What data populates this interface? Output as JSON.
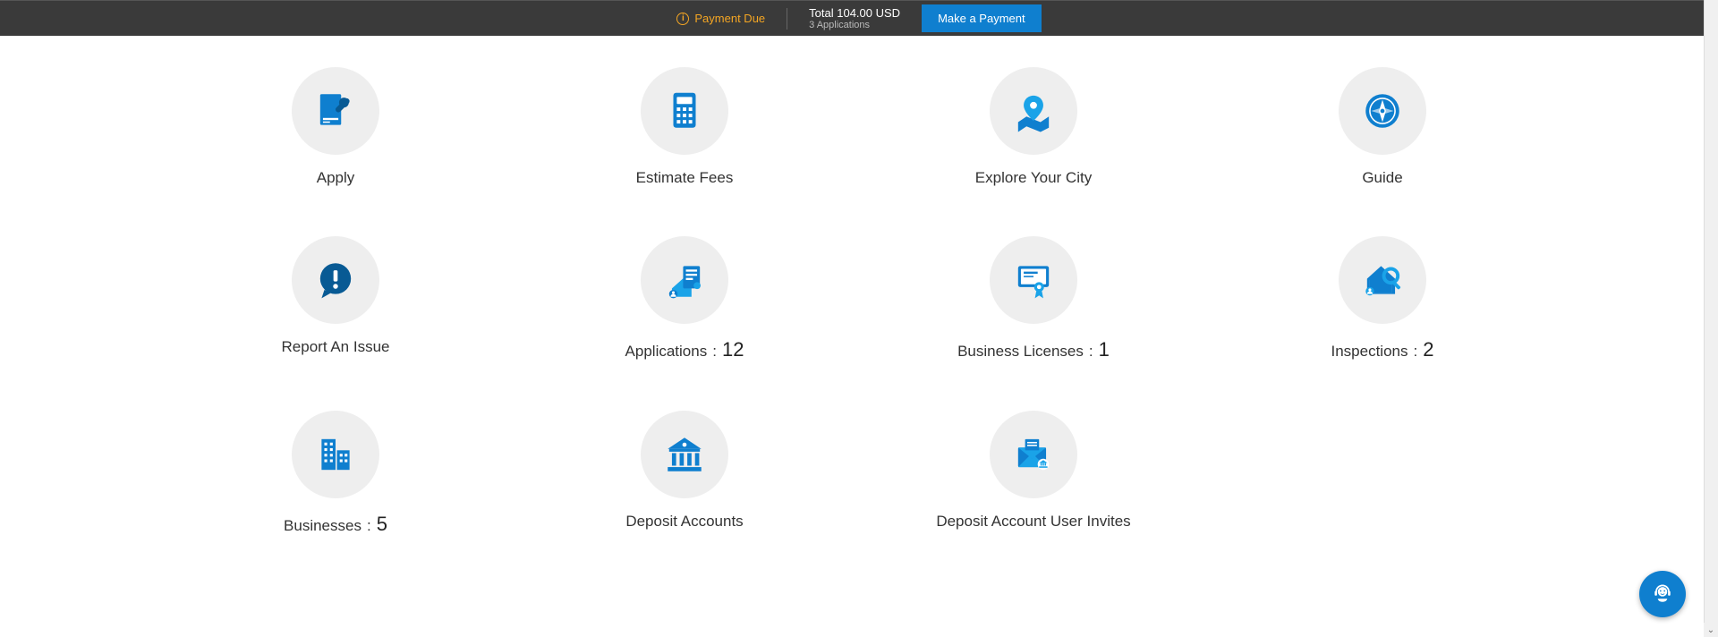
{
  "banner": {
    "payment_due_label": "Payment Due",
    "total_label": "Total 104.00 USD",
    "applications_label": "3 Applications",
    "make_payment_label": "Make a Payment"
  },
  "tiles": {
    "apply": {
      "label": "Apply"
    },
    "estimate_fees": {
      "label": "Estimate Fees"
    },
    "explore": {
      "label": "Explore Your City"
    },
    "guide": {
      "label": "Guide"
    },
    "report_issue": {
      "label": "Report An Issue"
    },
    "applications": {
      "label": "Applications",
      "count": "12"
    },
    "business_licenses": {
      "label": "Business Licenses",
      "count": "1"
    },
    "inspections": {
      "label": "Inspections",
      "count": "2"
    },
    "businesses": {
      "label": "Businesses",
      "count": "5"
    },
    "deposit_accounts": {
      "label": "Deposit Accounts"
    },
    "deposit_invites": {
      "label": "Deposit Account User Invites"
    }
  }
}
